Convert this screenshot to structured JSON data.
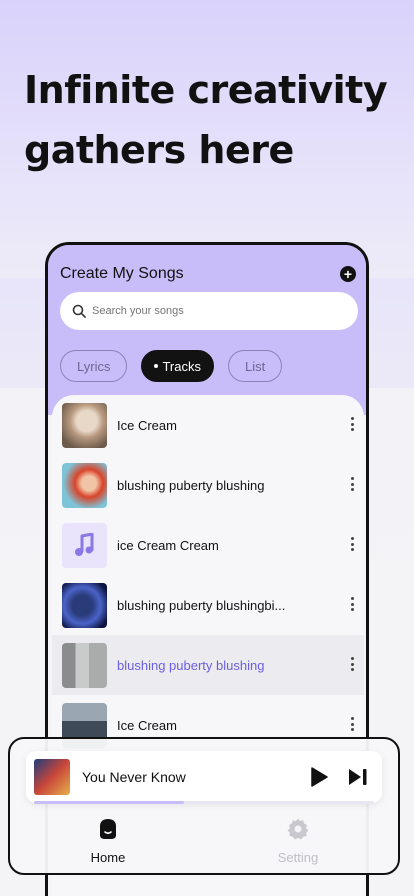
{
  "headline": "Infinite creativity gathers here",
  "app": {
    "title": "Create My Songs",
    "add_icon": "plus-circle-icon",
    "search": {
      "placeholder": "Search your songs",
      "icon": "search-icon"
    },
    "tabs": [
      {
        "label": "Lyrics",
        "active": false
      },
      {
        "label": "Tracks",
        "active": true
      },
      {
        "label": "List",
        "active": false
      }
    ],
    "songs": [
      {
        "title": "Ice Cream",
        "thumb": "statue-art",
        "selected": false
      },
      {
        "title": "blushing puberty blushing",
        "thumb": "red-hair-portrait",
        "selected": false
      },
      {
        "title": "ice Cream Cream",
        "thumb": "music-note-icon",
        "selected": false
      },
      {
        "title": "blushing puberty blushingbi...",
        "thumb": "blue-guitar-art",
        "selected": false
      },
      {
        "title": "blushing puberty blushing",
        "thumb": "gray-room-photo",
        "selected": true
      },
      {
        "title": "Ice Cream",
        "thumb": "city-photo",
        "selected": false
      }
    ]
  },
  "player": {
    "title": "You Never Know",
    "progress": 0.44,
    "play_icon": "play-icon",
    "next_icon": "next-track-icon"
  },
  "nav": {
    "home": "Home",
    "setting": "Setting"
  },
  "colors": {
    "accent": "#6b5ee0",
    "header_purple": "#c8bdf8",
    "inactive": "#c0bfc6"
  }
}
